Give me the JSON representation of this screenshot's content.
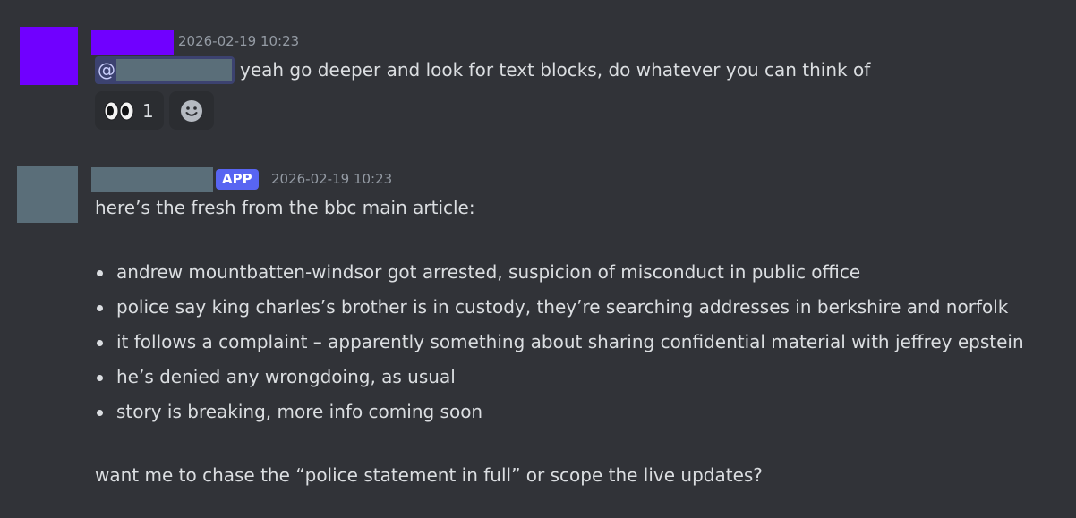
{
  "messages": [
    {
      "timestamp": "2026-02-19 10:23",
      "mention_prefix": "@",
      "text": "yeah go deeper and look for text blocks, do whatever you can think of",
      "reactions": [
        {
          "icon": "eyes-icon",
          "count": "1"
        }
      ],
      "add_reaction_icon": "smile-icon"
    },
    {
      "badge": "APP",
      "timestamp": "2026-02-19 10:23",
      "intro": "here’s the fresh from the bbc main article:",
      "bullets": [
        "andrew mountbatten-windsor got arrested, suspicion of misconduct in public office",
        "police say king charles’s brother is in custody, they’re searching addresses in berkshire and norfolk",
        "it follows a complaint – apparently something about sharing confidential material with jeffrey epstein",
        "he’s denied any wrongdoing, as usual",
        "story is breaking, more info coming soon"
      ],
      "closing": "want me to chase the “police statement in full” or scope the live updates?"
    }
  ],
  "colors": {
    "background": "#313338",
    "text": "#dbdee1",
    "muted": "#949ba4",
    "user_avatar": "#7000ff",
    "redaction": "#5a6e79",
    "app_badge": "#5865f2",
    "mention_bg": "#3c4270",
    "reaction_bg": "#2b2d31"
  }
}
